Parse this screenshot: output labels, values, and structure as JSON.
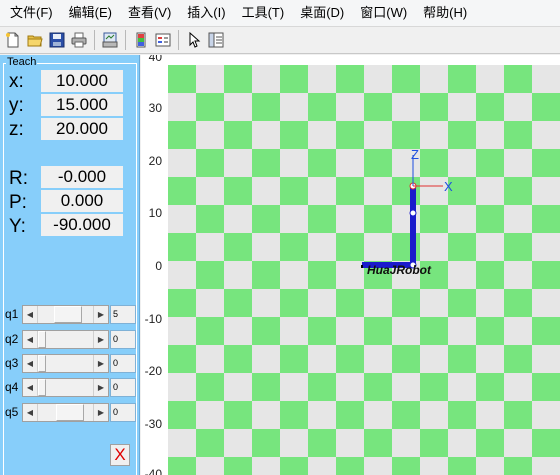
{
  "menubar": {
    "items": [
      "文件(F)",
      "编辑(E)",
      "查看(V)",
      "插入(I)",
      "工具(T)",
      "桌面(D)",
      "窗口(W)",
      "帮助(H)"
    ]
  },
  "toolbar": {
    "icons": [
      "new-file-icon",
      "open-folder-icon",
      "save-icon",
      "print-icon",
      "print-figure-icon",
      "colorbar-icon",
      "legend-icon",
      "pointer-icon",
      "property-inspector-icon"
    ]
  },
  "teach": {
    "title": "Teach",
    "coords": [
      {
        "label": "x:",
        "value": "10.000"
      },
      {
        "label": "y:",
        "value": "15.000"
      },
      {
        "label": "z:",
        "value": "20.000"
      },
      {
        "label": "R:",
        "value": "-0.000"
      },
      {
        "label": "P:",
        "value": "0.000"
      },
      {
        "label": "Y:",
        "value": "-90.000"
      }
    ],
    "joints": [
      {
        "label": "q1",
        "value": "5",
        "position": 0.4
      },
      {
        "label": "q2",
        "value": "0",
        "position": 0.0
      },
      {
        "label": "q3",
        "value": "0",
        "position": 0.0
      },
      {
        "label": "q4",
        "value": "0",
        "position": 0.0
      },
      {
        "label": "q5",
        "value": "0",
        "position": 0.45
      }
    ],
    "close_label": "X"
  },
  "plot": {
    "y_ticks": [
      "40",
      "30",
      "20",
      "10",
      "0",
      "-10",
      "-20",
      "-30",
      "-40"
    ],
    "robot_name": "HuaJRobot",
    "frame_axes": {
      "z": "Z",
      "x": "X"
    },
    "colors": {
      "checker_green": "#77e57e",
      "checker_gray": "#e6e6e6",
      "robot_blue": "#1a1acc",
      "axis_blue": "#1f4fe0",
      "axis_red": "#e03030"
    }
  }
}
